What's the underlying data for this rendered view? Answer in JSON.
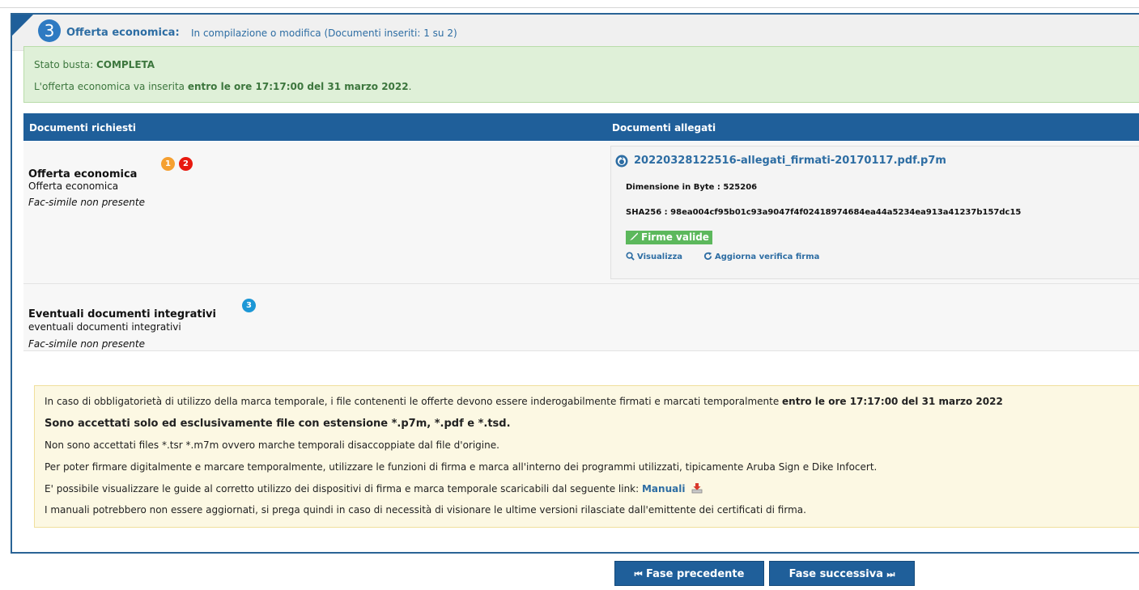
{
  "step": {
    "number": "3",
    "title": "Offerta economica:",
    "status": "In compilazione o modifica (Documenti inseriti: 1 su 2)"
  },
  "envelope": {
    "status_label": "Stato busta: ",
    "status_value": "COMPLETA",
    "deadline_prefix": "L'offerta economica va inserita ",
    "deadline_value": "entro le ore 17:17:00 del 31 marzo 2022",
    "deadline_suffix": "."
  },
  "table": {
    "col_required": "Documenti richiesti",
    "col_attached": "Documenti allegati"
  },
  "documents": [
    {
      "title": "Offerta economica",
      "subtitle": "Offerta economica",
      "note": "Fac-simile non presente",
      "badges": [
        "1",
        "2"
      ]
    },
    {
      "title": "Eventuali documenti integrativi",
      "subtitle": "eventuali documenti integrativi",
      "note": "Fac-simile non presente",
      "badges": [
        "3"
      ]
    }
  ],
  "attachment": {
    "filename": "20220328122516-allegati_firmati-20170117.pdf.p7m",
    "size": "Dimensione in Byte : 525206",
    "sha": "SHA256 : 98ea004cf95b01c93a9047f4f02418974684ea44a5234ea913a41237b157dc15",
    "signature_status": "Firme valide",
    "view_label": "Visualizza",
    "refresh_label": "Aggiorna verifica firma"
  },
  "notice": {
    "line1_text": "In caso di obbligatorietà di utilizzo della marca temporale, i file contenenti le offerte devono essere inderogabilmente firmati e marcati temporalmente ",
    "line1_bold": "entro le ore 17:17:00 del 31 marzo 2022",
    "line2": "Sono accettati solo ed esclusivamente file con estensione *.p7m, *.pdf e *.tsd.",
    "line3": "Non sono accettati files *.tsr *.m7m ovvero marche temporali disaccoppiate dal file d'origine.",
    "line4": "Per poter firmare digitalmente e marcare temporalmente, utilizzare le funzioni di firma e marca all'interno dei programmi utilizzati, tipicamente Aruba Sign e Dike Infocert.",
    "line5_text": "E' possibile visualizzare le guide al corretto utilizzo dei dispositivi di firma e marca temporale scaricabili dal seguente link: ",
    "line5_link": "Manuali",
    "line6": "I manuali potrebbero non essere aggiornati, si prega quindi in caso di necessità di visionare le ultime versioni rilasciate dall'emittente dei certificati di firma."
  },
  "navigation": {
    "prev": "Fase precedente",
    "next": "Fase successiva",
    "prev_arrow": "⏮",
    "next_arrow": "⏭"
  },
  "colors": {
    "primary": "#1f5f9a",
    "link": "#2d6da3",
    "success_bg": "#dff0d8",
    "warning_bg": "#fcf8e3",
    "badge_orange": "#f5a031",
    "badge_red": "#e8190f",
    "badge_blue": "#1c97d6",
    "signature_ok": "#5cb85c"
  }
}
